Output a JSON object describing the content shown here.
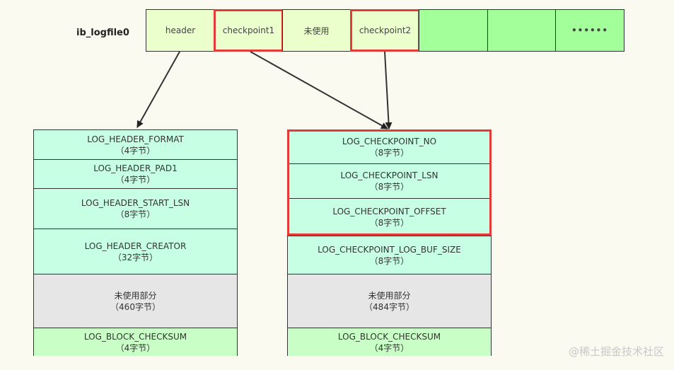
{
  "file": {
    "label": "ib_logfile0",
    "cells": [
      {
        "label": "header",
        "style": "light",
        "highlighted": false
      },
      {
        "label": "checkpoint1",
        "style": "light",
        "highlighted": true
      },
      {
        "label": "未使用",
        "style": "light",
        "highlighted": false
      },
      {
        "label": "checkpoint2",
        "style": "light",
        "highlighted": true
      },
      {
        "label": "",
        "style": "green",
        "highlighted": false
      },
      {
        "label": "",
        "style": "green",
        "highlighted": false
      },
      {
        "label": "••••••",
        "style": "green",
        "highlighted": false
      }
    ]
  },
  "header_block": {
    "rows": [
      {
        "name": "LOG_HEADER_FORMAT",
        "size": "（4字节）",
        "style": "mint"
      },
      {
        "name": "LOG_HEADER_PAD1",
        "size": "（4字节）",
        "style": "mint"
      },
      {
        "name": "LOG_HEADER_START_LSN",
        "size": "（8字节）",
        "style": "mint"
      },
      {
        "name": "LOG_HEADER_CREATOR",
        "size": "（32字节）",
        "style": "mint"
      },
      {
        "name": "未使用部分",
        "size": "（460字节）",
        "style": "gray"
      },
      {
        "name": "LOG_BLOCK_CHECKSUM",
        "size": "（4字节）",
        "style": "lime"
      }
    ]
  },
  "checkpoint_block": {
    "rows": [
      {
        "name": "LOG_CHECKPOINT_NO",
        "size": "（8字节）",
        "style": "mint"
      },
      {
        "name": "LOG_CHECKPOINT_LSN",
        "size": "（8字节）",
        "style": "mint"
      },
      {
        "name": "LOG_CHECKPOINT_OFFSET",
        "size": "（8字节）",
        "style": "mint"
      },
      {
        "name": "LOG_CHECKPOINT_LOG_BUF_SIZE",
        "size": "（8字节）",
        "style": "mint"
      },
      {
        "name": "未使用部分",
        "size": "（484字节）",
        "style": "gray"
      },
      {
        "name": "LOG_BLOCK_CHECKSUM",
        "size": "（4字节）",
        "style": "lime"
      }
    ]
  },
  "colors": {
    "highlight": "#e33a3a",
    "light_cell": "#eaffcc",
    "green_cell": "#a3ff9a",
    "mint_row": "#c6ffe4",
    "gray_row": "#e6e6e6",
    "lime_row": "#c9ffc6"
  },
  "watermark": "@稀土掘金技术社区"
}
